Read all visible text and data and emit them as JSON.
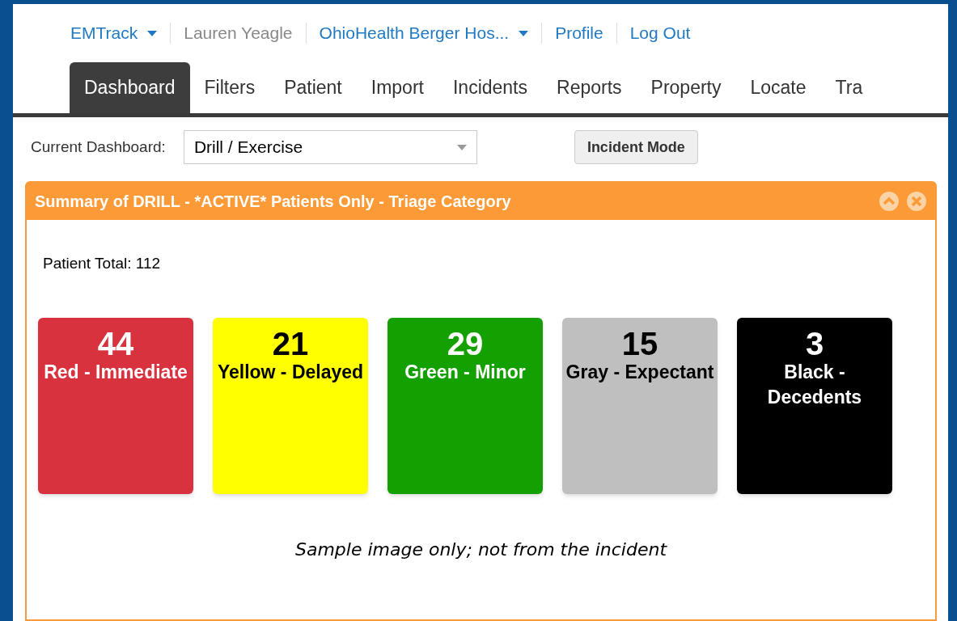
{
  "top_nav": [
    {
      "label": "EMTrack",
      "kind": "dropdown"
    },
    {
      "label": "Lauren Yeagle",
      "kind": "text"
    },
    {
      "label": "OhioHealth Berger Hos...",
      "kind": "dropdown"
    },
    {
      "label": "Profile",
      "kind": "link"
    },
    {
      "label": "Log Out",
      "kind": "link"
    }
  ],
  "tabs": [
    {
      "label": "Dashboard",
      "selected": true
    },
    {
      "label": "Filters",
      "selected": false
    },
    {
      "label": "Patient",
      "selected": false
    },
    {
      "label": "Import",
      "selected": false
    },
    {
      "label": "Incidents",
      "selected": false
    },
    {
      "label": "Reports",
      "selected": false
    },
    {
      "label": "Property",
      "selected": false
    },
    {
      "label": "Locate",
      "selected": false
    },
    {
      "label": "Tra",
      "selected": false
    }
  ],
  "toolbar": {
    "dashboard_label": "Current Dashboard:",
    "dashboard_value": "Drill / Exercise",
    "mode_button": "Incident Mode"
  },
  "panel": {
    "title": "Summary of DRILL - *ACTIVE* Patients Only - Triage Category",
    "patient_total": "Patient Total: 112",
    "categories": [
      {
        "count": "44",
        "label": "Red - Immediate",
        "color": "#d9323f"
      },
      {
        "count": "21",
        "label": "Yellow - Delayed",
        "color": "#ffff00"
      },
      {
        "count": "29",
        "label": "Green - Minor",
        "color": "#13a000"
      },
      {
        "count": "15",
        "label": "Gray - Expectant",
        "color": "#bfbfbf"
      },
      {
        "count": "3",
        "label": "Black - Decedents",
        "color": "#000000"
      }
    ],
    "caption": "Sample image only; not from the incident"
  }
}
